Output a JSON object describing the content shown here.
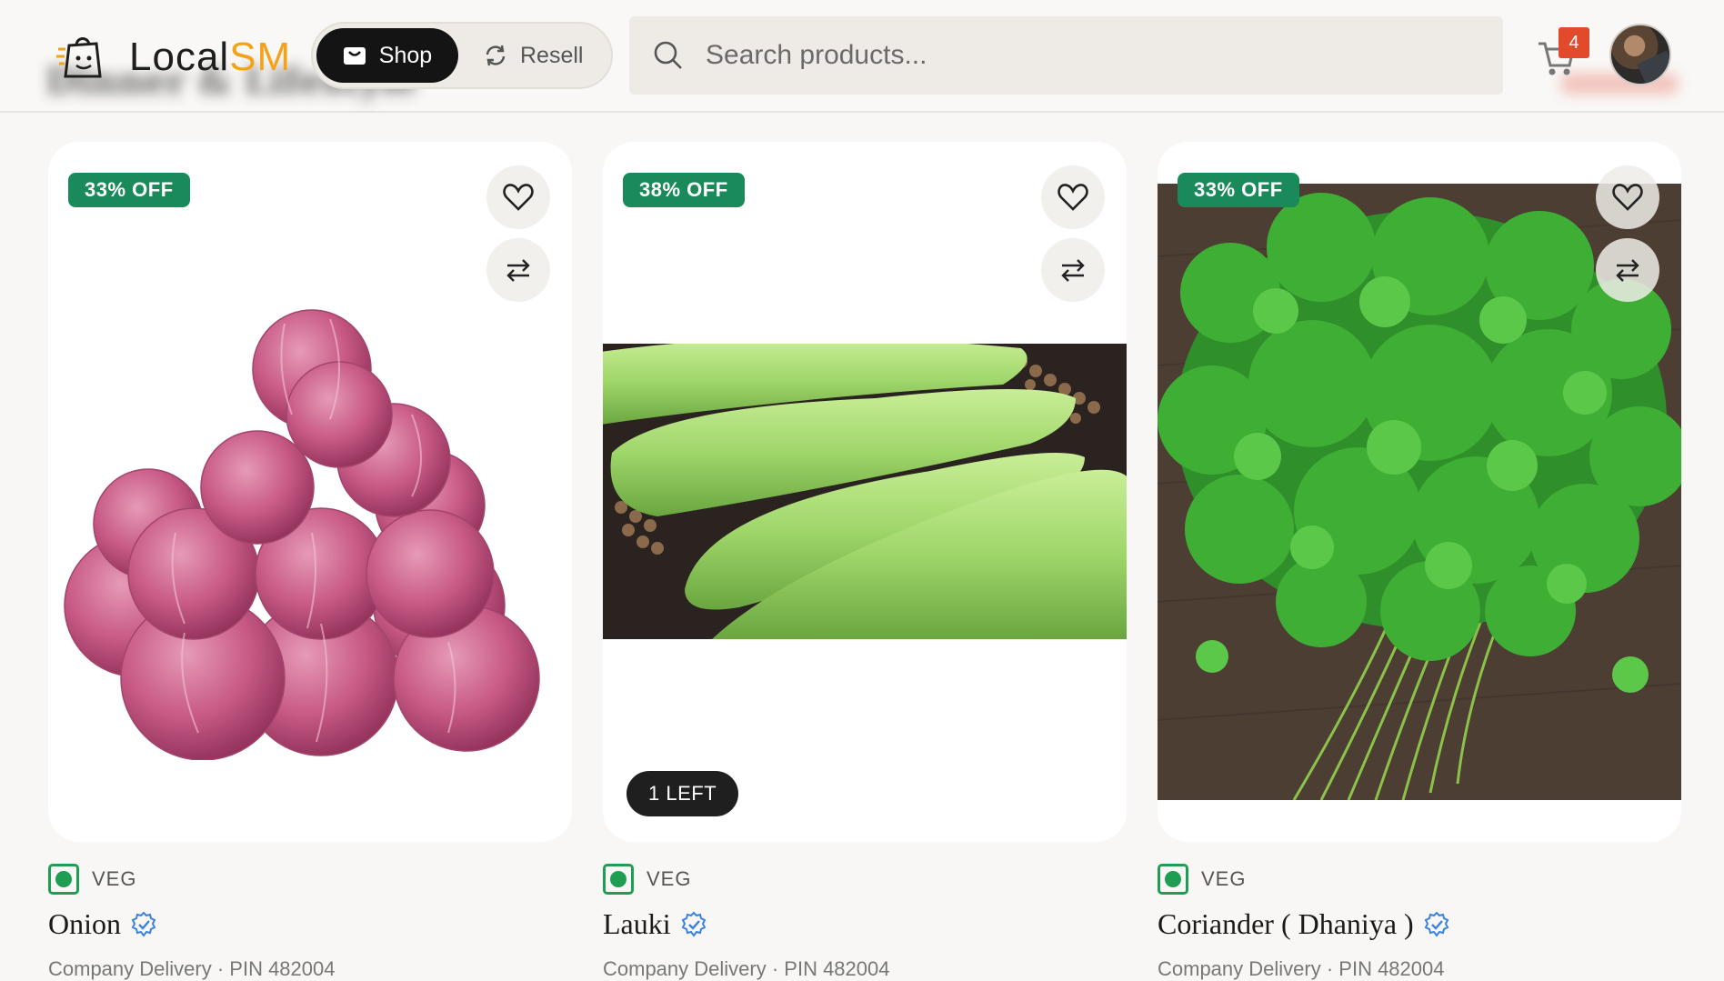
{
  "header": {
    "blurred_heading": "Dinner & Lifestyle",
    "logo": {
      "part1": "Local",
      "part2": "SM"
    },
    "toggle": {
      "shop": "Shop",
      "resell": "Resell"
    },
    "search": {
      "placeholder": "Search products..."
    },
    "cart": {
      "count": "4"
    }
  },
  "products": [
    {
      "name": "Onion",
      "discount": "33% OFF",
      "veg_label": "VEG",
      "delivery": "Company Delivery · PIN 482004",
      "stock_badge": ""
    },
    {
      "name": "Lauki",
      "discount": "38% OFF",
      "veg_label": "VEG",
      "delivery": "Company Delivery · PIN 482004",
      "stock_badge": "1 LEFT"
    },
    {
      "name": "Coriander ( Dhaniya )",
      "discount": "33% OFF",
      "veg_label": "VEG",
      "delivery": "Company Delivery · PIN 482004",
      "stock_badge": ""
    }
  ],
  "colors": {
    "accent_orange": "#f5a21b",
    "discount_green": "#1b8a5a",
    "veg_green": "#1e9e52",
    "cart_badge": "#e14b2c",
    "verified_blue": "#3b82e0"
  },
  "icons": [
    "shop-icon",
    "resell-icon",
    "search-icon",
    "cart-icon",
    "heart-icon",
    "compare-icon",
    "verified-icon"
  ]
}
